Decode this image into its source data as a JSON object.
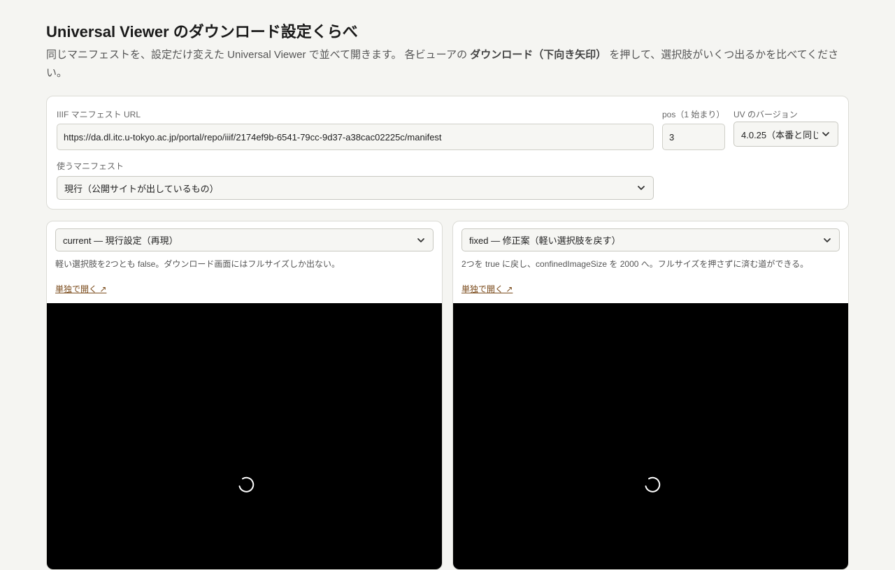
{
  "page": {
    "title": "Universal Viewer のダウンロード設定くらべ",
    "intro_before": "同じマニフェストを、設定だけ変えた Universal Viewer で並べて開きます。 各ビューアの ",
    "intro_bold": "ダウンロード（下向き矢印）",
    "intro_after": " を押して、選択肢がいくつ出るかを比べてください。"
  },
  "settings": {
    "manifest_url_label": "IIIF マニフェスト URL",
    "manifest_url_value": "https://da.dl.itc.u-tokyo.ac.jp/portal/repo/iiif/2174ef9b-6541-79cc-9d37-a38cac02225c/manifest",
    "pos_label": "pos（1 始まり）",
    "pos_value": "3",
    "uv_version_label": "UV のバージョン",
    "uv_version_selected": "4.0.25（本番と同じ）",
    "manifest_choice_label": "使うマニフェスト",
    "manifest_choice_selected": "現行（公開サイトが出しているもの）"
  },
  "panels": [
    {
      "config_selected": "current — 現行設定（再現）",
      "description": "軽い選択肢を2つとも false。ダウンロード画面にはフルサイズしか出ない。",
      "open_link": "単独で開く ↗"
    },
    {
      "config_selected": "fixed — 修正案（軽い選択肢を戻す）",
      "description": "2つを true に戻し、confinedImageSize を 2000 へ。フルサイズを押さずに済む道ができる。",
      "open_link": "単独で開く ↗"
    }
  ],
  "icons": {
    "select_chevron": "chevron-down-icon",
    "loading": "loading-spinner-icon"
  },
  "colors": {
    "background": "#f5f5f2",
    "viewer_background": "#000000",
    "link": "#7a4a1a"
  }
}
